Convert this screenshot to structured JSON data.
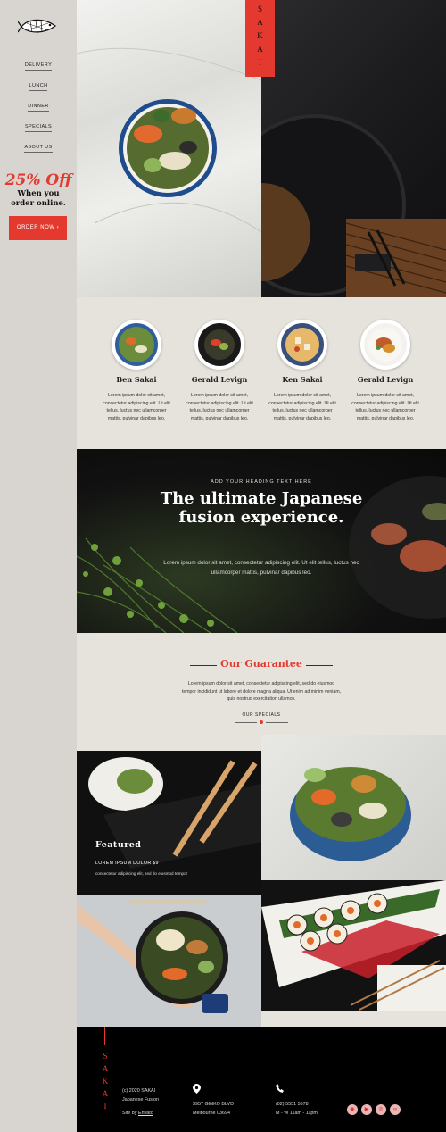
{
  "brand": {
    "name": "SAKAI",
    "letters": [
      "S",
      "A",
      "K",
      "A",
      "I"
    ]
  },
  "nav": {
    "items": [
      "DELIVERY",
      "LUNCH",
      "DINNER",
      "SPECIALS",
      "ABOUT US"
    ]
  },
  "promo": {
    "headline": "25% Off",
    "sub_line1": "When you",
    "sub_line2": "order online.",
    "button": "ORDER NOW  ›"
  },
  "team": [
    {
      "name": "Ben Sakai",
      "text": "Lorem ipsum dolor sit amet, consectetur adipiscing elit. Ut elit tellus, luctus nec ullamcorper mattis, pulvinar dapibus leo."
    },
    {
      "name": "Gerald Levign",
      "text": "Lorem ipsum dolor sit amet, consectetur adipiscing elit. Ut elit tellus, luctus nec ullamcorper mattis, pulvinar dapibus leo."
    },
    {
      "name": "Ken Sakai",
      "text": "Lorem ipsum dolor sit amet, consectetur adipiscing elit. Ut elit tellus, luctus nec ullamcorper mattis, pulvinar dapibus leo."
    },
    {
      "name": "Gerald Levign",
      "text": "Lorem ipsum dolor sit amet, consectetur adipiscing elit. Ut elit tellus, luctus nec ullamcorper mattis, pulvinar dapibus leo."
    }
  ],
  "banner": {
    "kicker": "ADD YOUR HEADING TEXT HERE",
    "title_line1": "The ultimate Japanese",
    "title_line2": "fusion experience.",
    "text": "Lorem ipsum dolor sit amet, consectetur adipiscing elit. Ut elit tellus, luctus nec ullamcorper mattis, pulvinar dapibus leo."
  },
  "guarantee": {
    "title": "Our Guarantee",
    "text": "Lorem ipsum dolor sit amet, consectetur adipiscing elit, sed do eiusmod tempor incididunt ut labore et dolore magna aliqua. Ut enim ad minim veniam, quis nostrud exercitation ullamco.",
    "link": "OUR SPECIALS"
  },
  "featured": {
    "title": "Featured",
    "subtitle": "LOREM IPSUM DOLOR $9",
    "text": "consectetur adipiscing elit, sed do eiusmod tempor"
  },
  "footer": {
    "copyright_line1": "(c) 2020 SAKAI",
    "copyright_line2": "Japanese Fusion",
    "site_by_label": "Site by",
    "site_by_link": "Envato",
    "address_line1": "3957 GINKO BLVD",
    "address_line2": "Melbourne 03694",
    "phone": "(02) 5551 5678",
    "hours": "M - W 11am - 11pm"
  },
  "icons": [
    "fish-logo-icon",
    "location-pin-icon",
    "phone-icon",
    "instagram-icon",
    "youtube-icon",
    "pinterest-icon",
    "tripadvisor-icon"
  ],
  "colors": {
    "accent": "#e4392f",
    "background": "#e6e2dc",
    "sidebar": "#d8d5d0",
    "footer": "#000000"
  }
}
